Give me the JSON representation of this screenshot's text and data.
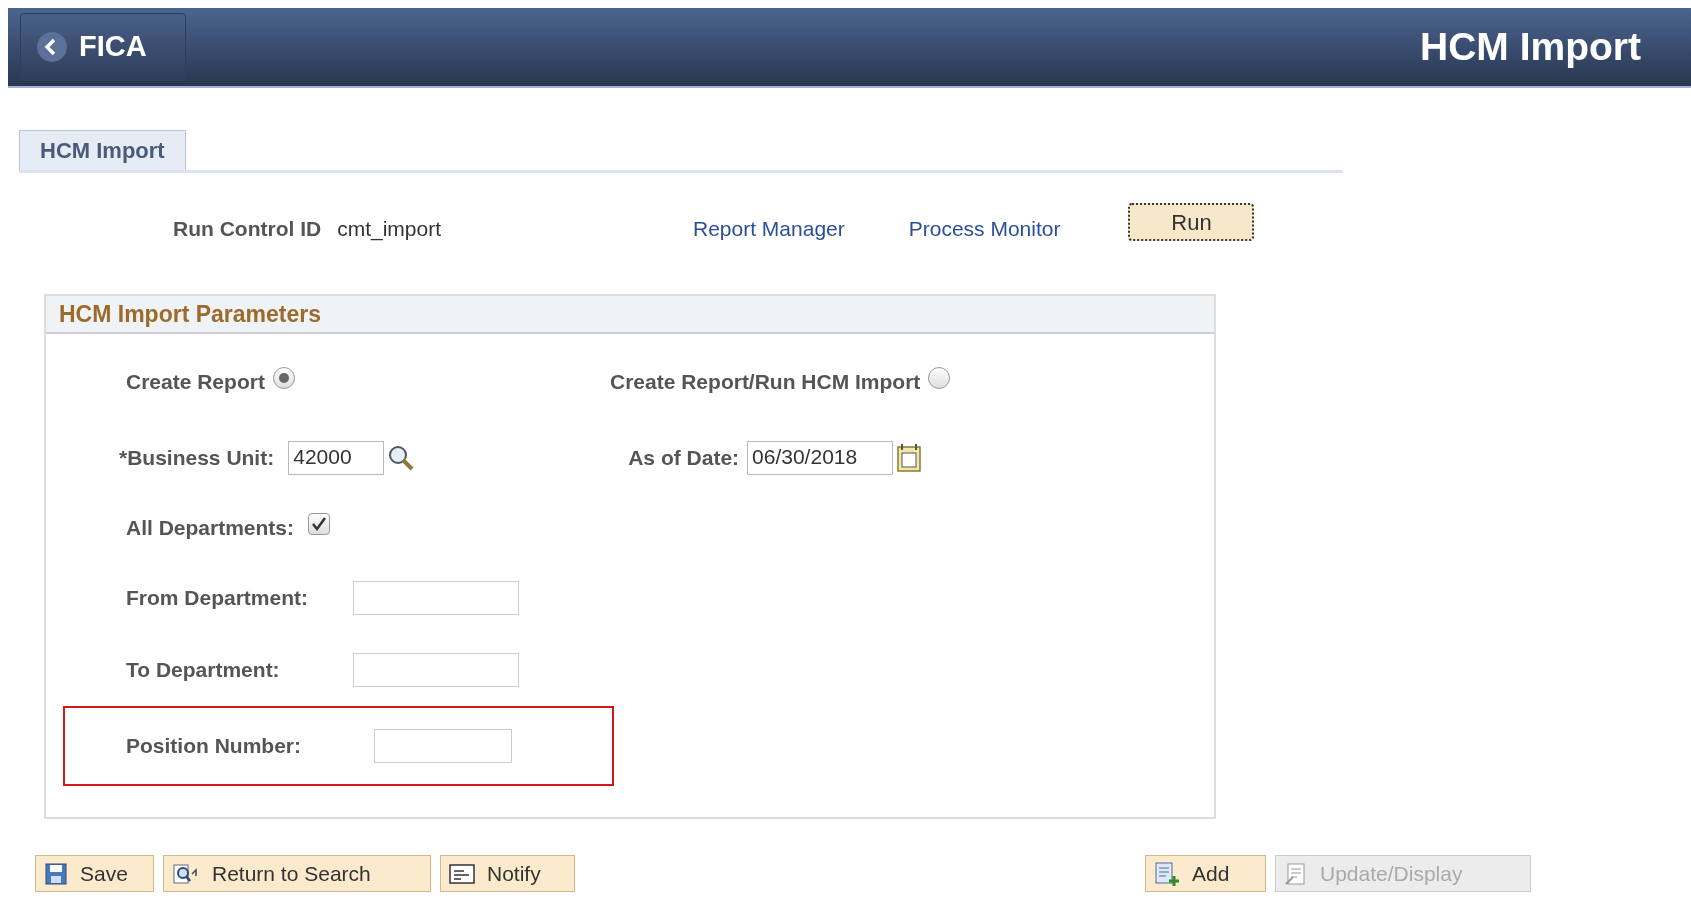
{
  "header": {
    "back_label": "FICA",
    "title": "HCM Import"
  },
  "tabs": [
    {
      "label": "HCM Import",
      "selected": true
    }
  ],
  "run_control": {
    "label": "Run Control ID",
    "value": "cmt_import"
  },
  "links": [
    "Report Manager",
    "Process Monitor"
  ],
  "run_button": "Run",
  "parameters": {
    "title": "HCM Import Parameters",
    "options": [
      {
        "label": "Create Report",
        "selected": true
      },
      {
        "label": "Create Report/Run HCM Import",
        "selected": false
      }
    ],
    "business_unit": {
      "label": "*Business Unit:",
      "value": "42000"
    },
    "as_of_date": {
      "label": "As of Date:",
      "value": "06/30/2018"
    },
    "all_departments": {
      "label": "All Departments:",
      "checked": true
    },
    "from_department": {
      "label": "From Department:"
    },
    "to_department": {
      "label": "To Department:"
    },
    "position_number": {
      "label": "Position Number:",
      "highlighted": true
    }
  },
  "toolbar_left": [
    {
      "kind": "save",
      "label": "Save",
      "disabled": false
    },
    {
      "kind": "return",
      "label": "Return to Search",
      "disabled": false
    },
    {
      "kind": "notify",
      "label": "Notify",
      "disabled": false
    }
  ],
  "toolbar_right": [
    {
      "kind": "add",
      "label": "Add",
      "disabled": false
    },
    {
      "kind": "update",
      "label": "Update/Display",
      "disabled": true
    }
  ]
}
